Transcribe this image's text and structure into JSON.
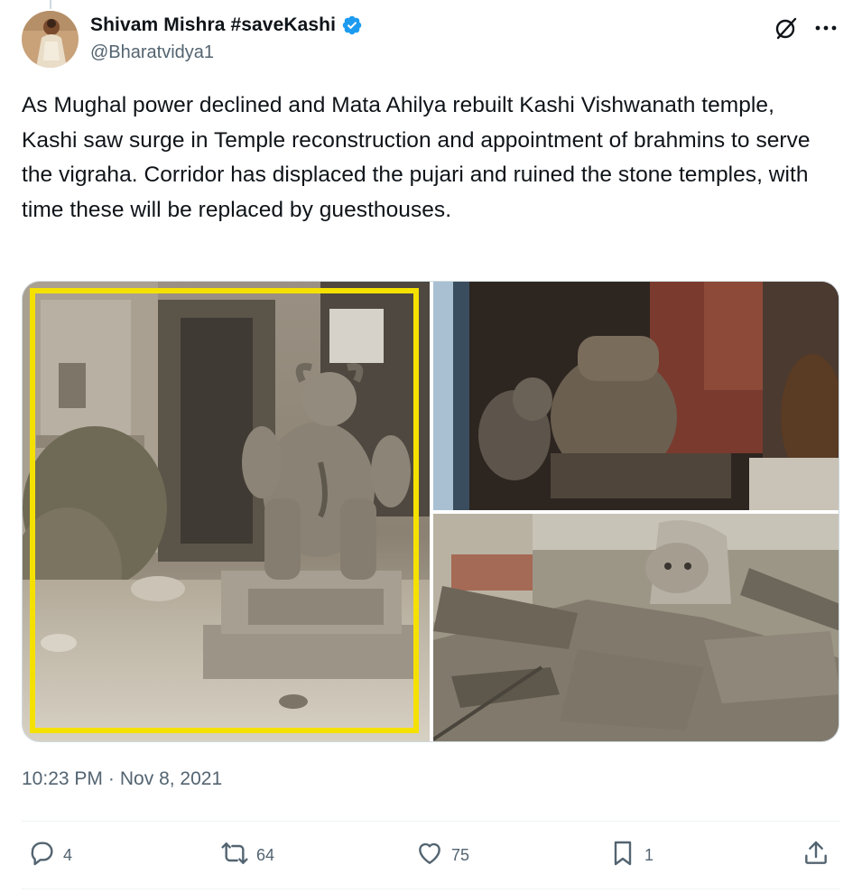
{
  "user": {
    "display_name": "Shivam Mishra #saveKashi",
    "handle": "@Bharatvidya1",
    "verified": true
  },
  "tweet": {
    "text": "As Mughal power declined and Mata Ahilya rebuilt Kashi Vishwanath temple, Kashi saw surge in Temple reconstruction and appointment of brahmins to serve the vigraha. Corridor has displaced the pujari and ruined the stone temples, with time these will be replaced by guesthouses.",
    "time": "10:23 PM",
    "separator": "·",
    "date": "Nov 8, 2021"
  },
  "media": {
    "photo_left": "stone-nandi-statue-photo",
    "photo_top_right": "nandi-statues-in-shrine-photo",
    "photo_bottom_right": "nandi-amid-debris-photo",
    "highlight_color": "#f5e100"
  },
  "actions": {
    "replies": "4",
    "reposts": "64",
    "likes": "75",
    "bookmarks": "1"
  },
  "icons": {
    "verified": "verified-badge-icon",
    "grok": "grok-icon",
    "more": "more-icon",
    "reply": "reply-icon",
    "repost": "repost-icon",
    "like": "heart-icon",
    "bookmark": "bookmark-icon",
    "share": "share-icon"
  },
  "colors": {
    "verified": "#1d9bf0",
    "secondary_text": "#536471",
    "primary_text": "#0f1419"
  }
}
